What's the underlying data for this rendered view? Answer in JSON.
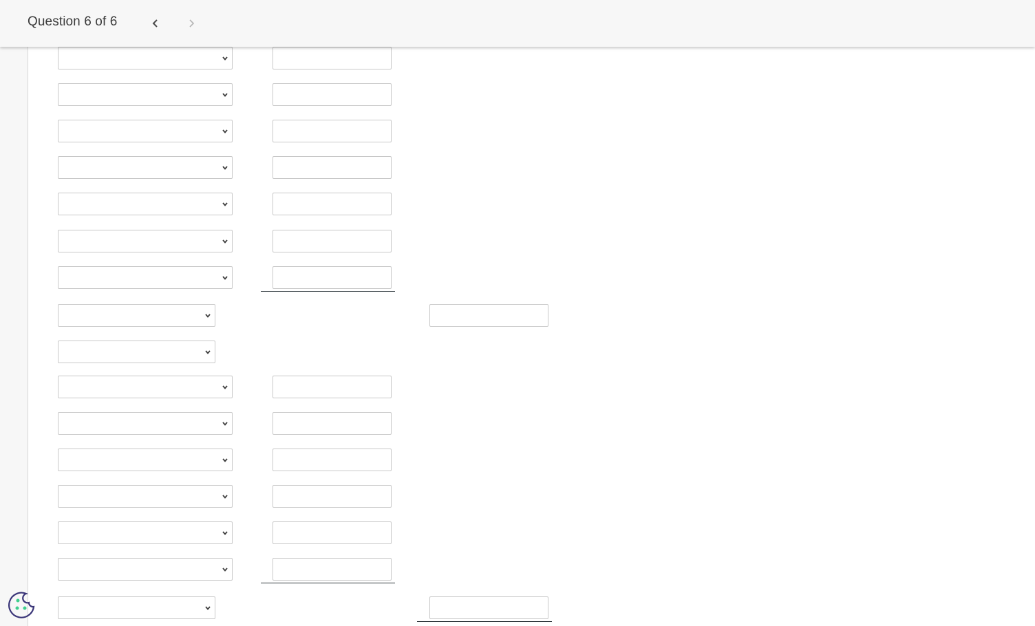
{
  "header": {
    "title": "Question 6 of 6",
    "prev_icon": "chevron-left-icon",
    "next_icon": "chevron-right-icon",
    "prev_enabled": true,
    "next_enabled": false
  },
  "form": {
    "rows": [
      {
        "type": "entry",
        "account": "",
        "amount": ""
      },
      {
        "type": "entry",
        "account": "",
        "amount": ""
      },
      {
        "type": "entry",
        "account": "",
        "amount": ""
      },
      {
        "type": "entry",
        "account": "",
        "amount": ""
      },
      {
        "type": "entry",
        "account": "",
        "amount": ""
      },
      {
        "type": "entry",
        "account": "",
        "amount": ""
      },
      {
        "type": "entry-underlined",
        "account": "",
        "amount": ""
      },
      {
        "type": "total",
        "label_select": "",
        "total": ""
      },
      {
        "type": "heading",
        "label_select": ""
      },
      {
        "type": "entry",
        "account": "",
        "amount": ""
      },
      {
        "type": "entry",
        "account": "",
        "amount": ""
      },
      {
        "type": "entry",
        "account": "",
        "amount": ""
      },
      {
        "type": "entry",
        "account": "",
        "amount": ""
      },
      {
        "type": "entry",
        "account": "",
        "amount": ""
      },
      {
        "type": "entry-underlined",
        "account": "",
        "amount": ""
      },
      {
        "type": "total-underlined",
        "label_select": "",
        "total": ""
      }
    ]
  },
  "cookie_button": {
    "icon": "cookie-icon",
    "colors": {
      "outline": "#3a3578",
      "dots": "#3ecf8e"
    }
  }
}
